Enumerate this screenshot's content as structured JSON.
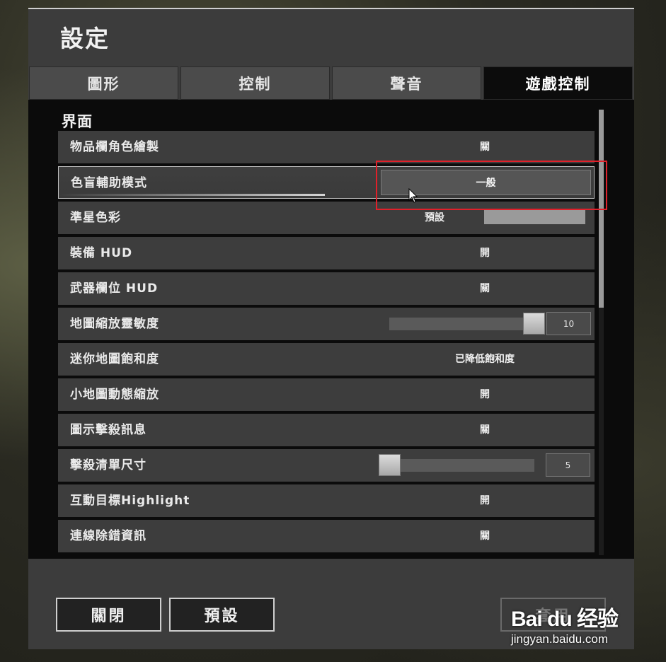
{
  "window": {
    "title": "設定"
  },
  "tabs": [
    {
      "label": "圖形",
      "active": false
    },
    {
      "label": "控制",
      "active": false
    },
    {
      "label": "聲音",
      "active": false
    },
    {
      "label": "遊戲控制",
      "active": true
    }
  ],
  "section": {
    "title": "界面"
  },
  "settings": [
    {
      "label": "物品欄角色繪製",
      "value": "關"
    },
    {
      "label": "色盲輔助模式",
      "value": "一般"
    },
    {
      "label": "準星色彩",
      "value": "預設"
    },
    {
      "label": "裝備 HUD",
      "value": "開"
    },
    {
      "label": "武器欄位 HUD",
      "value": "關"
    },
    {
      "label": "地圖縮放靈敏度",
      "value": "10"
    },
    {
      "label": "迷你地圖飽和度",
      "value": "已降低飽和度"
    },
    {
      "label": "小地圖動態縮放",
      "value": "開"
    },
    {
      "label": "圖示擊殺訊息",
      "value": "關"
    },
    {
      "label": "擊殺清單尺寸",
      "value": "5"
    },
    {
      "label": "互動目標Highlight",
      "value": "開"
    },
    {
      "label": "連線除錯資訊",
      "value": "關"
    }
  ],
  "sliders": {
    "map_zoom_sensitivity_fraction": 1.0,
    "kill_feed_size_fraction": 0.0
  },
  "footer": {
    "close_label": "關閉",
    "default_label": "預設",
    "apply_label": "套用"
  },
  "watermark": {
    "logo": "Bai du 经验",
    "url": "jingyan.baidu.com"
  },
  "colors": {
    "highlight_box": "#e0202a",
    "active_tab": "#0c0c0c"
  }
}
